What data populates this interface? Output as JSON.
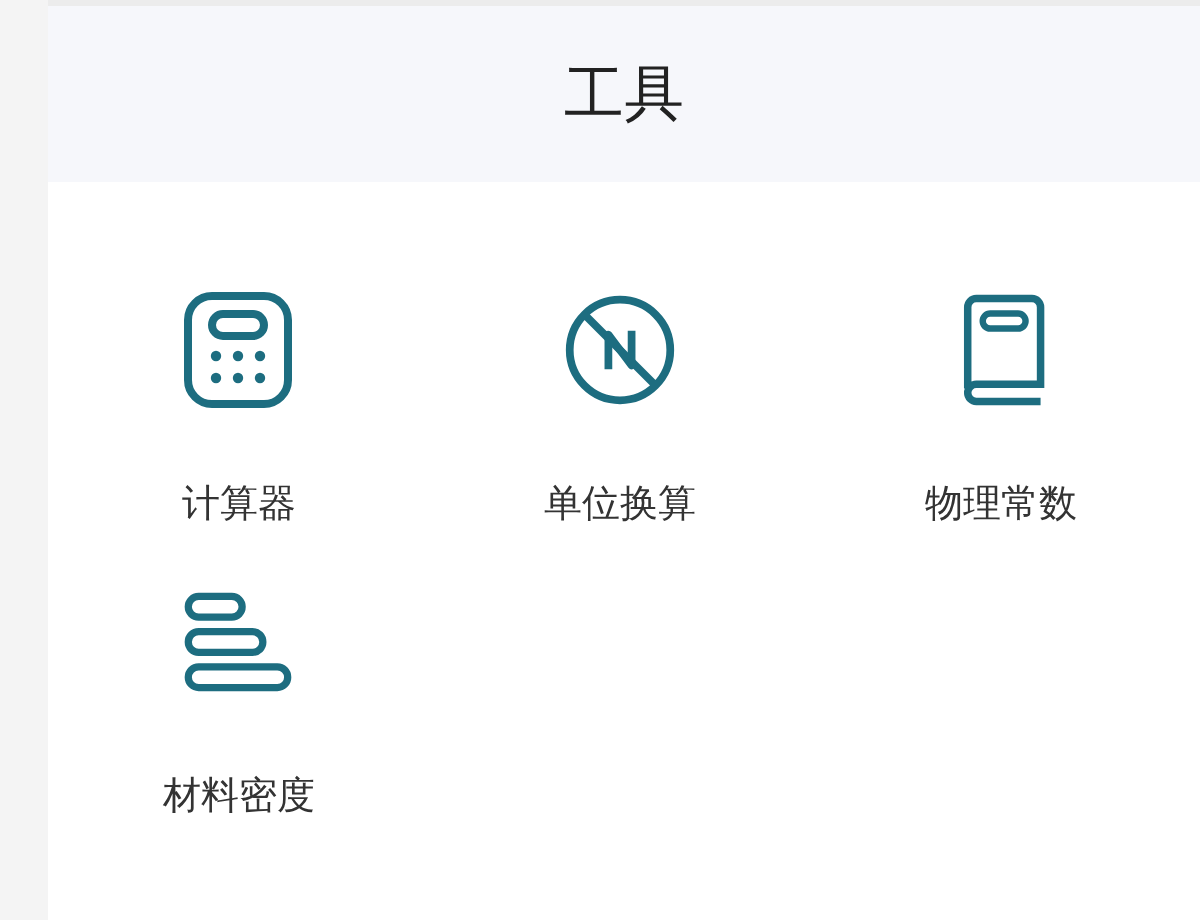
{
  "header": {
    "title": "工具"
  },
  "tools": [
    {
      "kind": "calculator",
      "label": "计算器"
    },
    {
      "kind": "convert",
      "label": "单位换算"
    },
    {
      "kind": "book",
      "label": "物理常数"
    },
    {
      "kind": "stack",
      "label": "材料密度"
    }
  ]
}
